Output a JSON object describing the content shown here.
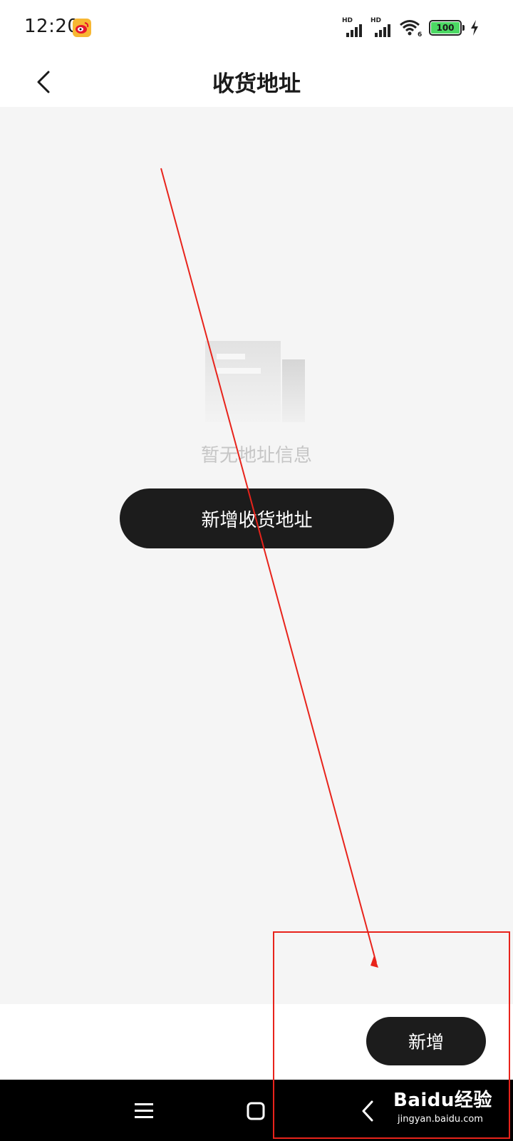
{
  "status_bar": {
    "time": "12:20",
    "battery_level": "100",
    "network_label_1": "HD",
    "network_label_2": "HD",
    "wifi_generation": "6",
    "icons": [
      "weibo-app-icon",
      "signal-icon",
      "signal-icon",
      "wifi-icon",
      "battery-icon",
      "charging-bolt-icon"
    ]
  },
  "header": {
    "title": "收货地址",
    "back_icon": "chevron-left-icon"
  },
  "empty_state": {
    "message": "暂无地址信息",
    "illustration": "empty-document-icon",
    "primary_button_label": "新增收货地址"
  },
  "bottom_bar": {
    "add_button_label": "新增"
  },
  "nav_bar": {
    "icons": [
      "menu-icon",
      "home-square-icon",
      "back-chevron-icon"
    ]
  },
  "watermark": {
    "brand": "Baidu经验",
    "url": "jingyan.baidu.com"
  },
  "colors": {
    "background": "#f5f5f5",
    "button": "#1c1c1c",
    "annotation": "#e8231b",
    "battery": "#4cd964"
  }
}
